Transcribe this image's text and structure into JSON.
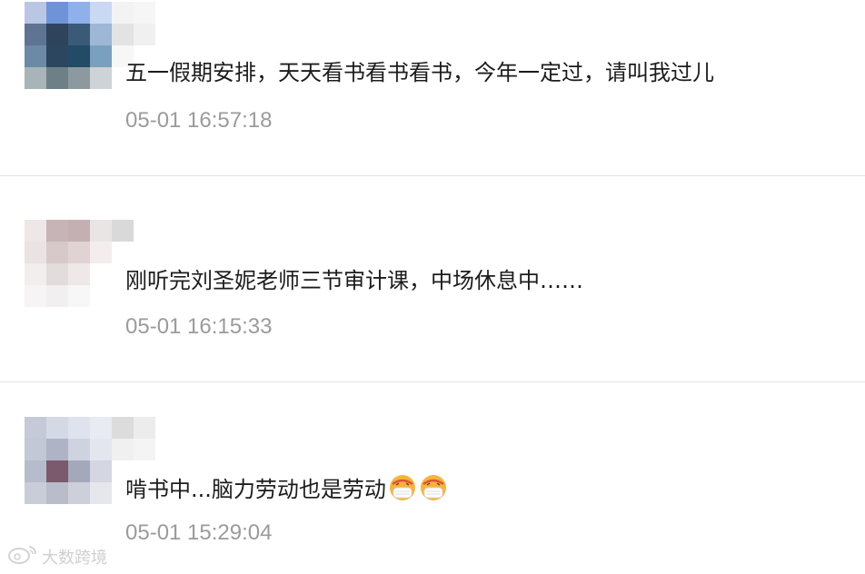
{
  "comments": [
    {
      "text": "五一假期安排，天天看书看书看书，今年一定过，请叫我过儿",
      "time": "05-01 16:57:18",
      "avatar_colors": [
        [
          "#b9c7e4",
          "#6f93d8",
          "#8fb0ea",
          "#c9d8f3",
          "#f3f3f3",
          "#f6f6f6"
        ],
        [
          "#5f7493",
          "#2e435c",
          "#3a5a78",
          "#9fb7d6",
          "#e3e3e3",
          "#f0f0f0"
        ],
        [
          "#6b8aa6",
          "#2d4660",
          "#214b66",
          "#7aa0c0",
          "#f7f7f7",
          "#ffffff"
        ],
        [
          "#a8b4b8",
          "#6d7f87",
          "#8c9aa0",
          "#cdd3d6",
          "#ffffff",
          "#ffffff"
        ]
      ]
    },
    {
      "text": "刚听完刘圣妮老师三节审计课，中场休息中……",
      "time": "05-01 16:15:33",
      "avatar_colors": [
        [
          "#efe7e7",
          "#c7b4b6",
          "#c4b0b2",
          "#e9e5e5",
          "#d9d9d9",
          "#ffffff"
        ],
        [
          "#ebe2e3",
          "#d7c9ca",
          "#e1d3d4",
          "#f3eded",
          "#ffffff",
          "#ffffff"
        ],
        [
          "#f2eeee",
          "#e3dcdd",
          "#efe8e8",
          "#ffffff",
          "#ffffff",
          "#ffffff"
        ],
        [
          "#f6f4f4",
          "#f1efef",
          "#f7f7f7",
          "#ffffff",
          "#ffffff",
          "#ffffff"
        ]
      ]
    },
    {
      "text": "啃书中...脑力劳动也是劳动",
      "time": "05-01 15:29:04",
      "avatar_colors": [
        [
          "#c6cad8",
          "#d5d9e6",
          "#dfe3ee",
          "#e8ebf2",
          "#dcdcdc",
          "#ececec"
        ],
        [
          "#c3c8d6",
          "#aeb3c6",
          "#cfd3e0",
          "#e3e6ee",
          "#f0f0f0",
          "#f4f4f4"
        ],
        [
          "#b6bccb",
          "#7a5a6c",
          "#a3a8ba",
          "#d4d7e2",
          "#ffffff",
          "#ffffff"
        ],
        [
          "#c9cdd7",
          "#b9bdca",
          "#cdd0da",
          "#e5e7ed",
          "#ffffff",
          "#ffffff"
        ]
      ],
      "emoji_icon": "mask-face-emoji"
    }
  ],
  "watermark": {
    "logo_icon": "weibo-logo-icon",
    "text": "大数跨境"
  }
}
